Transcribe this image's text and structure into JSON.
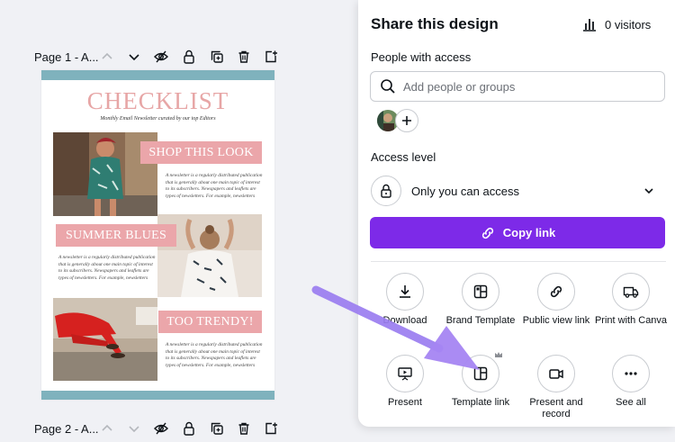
{
  "pages": [
    {
      "label": "Page 1 - A..."
    },
    {
      "label": "Page 2 - A..."
    }
  ],
  "design": {
    "title": "CHECKLIST",
    "subtitle": "Monthly Email Newsletter curated by our top Editors",
    "blocks": [
      {
        "heading": "SHOP THIS LOOK",
        "text": "A newsletter is a regularly distributed publication that is generally about one main topic of interest to its subscribers. Newspapers and leaflets are types of newsletters. For example, newsletters"
      },
      {
        "heading": "SUMMER BLUES",
        "text": "A newsletter is a regularly distributed publication that is generally about one main topic of interest to its subscribers. Newspapers and leaflets are types of newsletters. For example, newsletters"
      },
      {
        "heading": "TOO TRENDY!",
        "text": "A newsletter is a regularly distributed publication that is generally about one main topic of interest to its subscribers. Newspapers and leaflets are types of newsletters. For example, newsletters"
      }
    ],
    "colors": {
      "stripe": "#7fb2bd",
      "pink": "#eba6aa",
      "title": "#e7a6a6"
    }
  },
  "share": {
    "title": "Share this design",
    "visitors": "0 visitors",
    "people_label": "People with access",
    "search_placeholder": "Add people or groups",
    "access_label": "Access level",
    "access_value": "Only you can access",
    "copy_label": "Copy link",
    "accent": "#7d2ae8",
    "options": [
      {
        "label": "Download",
        "icon": "download-icon"
      },
      {
        "label": "Brand Template",
        "icon": "brand-template-icon"
      },
      {
        "label": "Public view link",
        "icon": "link-icon"
      },
      {
        "label": "Print with Canva",
        "icon": "truck-icon"
      },
      {
        "label": "Present",
        "icon": "present-icon"
      },
      {
        "label": "Template link",
        "icon": "template-icon"
      },
      {
        "label": "Present and record",
        "icon": "camera-icon"
      },
      {
        "label": "See all",
        "icon": "more-icon"
      }
    ]
  }
}
